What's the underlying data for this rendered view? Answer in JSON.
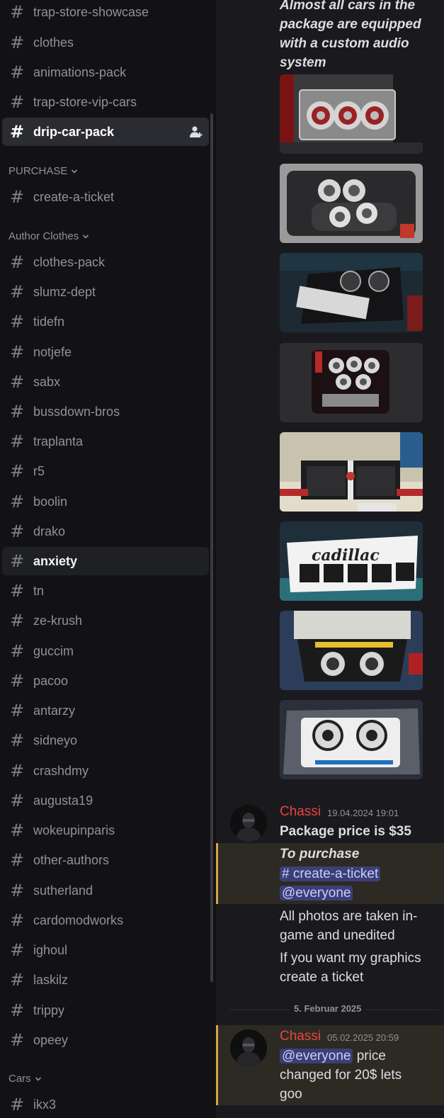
{
  "sidebar": {
    "channels_top": [
      {
        "name": "trap-store-showcase"
      },
      {
        "name": "clothes"
      },
      {
        "name": "animations-pack"
      },
      {
        "name": "trap-store-vip-cars"
      },
      {
        "name": "drip-car-pack",
        "selected": true
      }
    ],
    "categories": {
      "purchase": "PURCHASE",
      "author_clothes": "Author Clothes",
      "cars": "Cars"
    },
    "purchase_channels": [
      {
        "name": "create-a-ticket"
      }
    ],
    "author_channels": [
      {
        "name": "clothes-pack"
      },
      {
        "name": "slumz-dept"
      },
      {
        "name": "tidefn"
      },
      {
        "name": "notjefe"
      },
      {
        "name": "sabx"
      },
      {
        "name": "bussdown-bros"
      },
      {
        "name": "traplanta"
      },
      {
        "name": "r5"
      },
      {
        "name": "boolin"
      },
      {
        "name": "drako"
      },
      {
        "name": "anxiety",
        "hovered": true
      },
      {
        "name": "tn"
      },
      {
        "name": "ze-krush"
      },
      {
        "name": "guccim"
      },
      {
        "name": "pacoo"
      },
      {
        "name": "antarzy"
      },
      {
        "name": "sidneyo"
      },
      {
        "name": "crashdmy"
      },
      {
        "name": "augusta19"
      },
      {
        "name": "wokeupinparis"
      },
      {
        "name": "other-authors"
      },
      {
        "name": "sutherland"
      },
      {
        "name": "cardomodworks"
      },
      {
        "name": "ighoul"
      },
      {
        "name": "laskilz"
      },
      {
        "name": "trippy"
      },
      {
        "name": "opeey"
      }
    ],
    "cars_channels": [
      {
        "name": "ikx3"
      }
    ]
  },
  "chat": {
    "intro_text": "Almost all cars in the package are equipped with a custom audio system",
    "images": [
      {
        "alt": "trunk-three-subwoofers"
      },
      {
        "alt": "trunk-dual-subwoofers-box"
      },
      {
        "alt": "trunk-amplifier-setup"
      },
      {
        "alt": "trunk-five-speakers"
      },
      {
        "alt": "trunk-two-subwoofer-boxes"
      },
      {
        "alt": "cadillac-four-subwoofers"
      },
      {
        "alt": "suv-two-subwoofers"
      },
      {
        "alt": "trunk-white-subwoofer-box"
      }
    ],
    "message1": {
      "author": "Chassi",
      "timestamp": "19.04.2024 19:01",
      "line1": "Package price is $35",
      "line2": "To purchase",
      "channel_mention": "create-a-ticket",
      "everyone_mention": "@everyone",
      "line3": "All photos are taken in-game and unedited",
      "line4": "If you want my graphics create a ticket"
    },
    "date_divider": "5. Februar 2025",
    "message2": {
      "author": "Chassi",
      "timestamp": "05.02.2025 20:59",
      "everyone_mention": "@everyone",
      "text": "price changed for 20$ lets goo"
    }
  },
  "colors": {
    "accent_author": "#e7453d",
    "mention_border": "#d9a44a",
    "mention_pill": "#3c3f77"
  }
}
